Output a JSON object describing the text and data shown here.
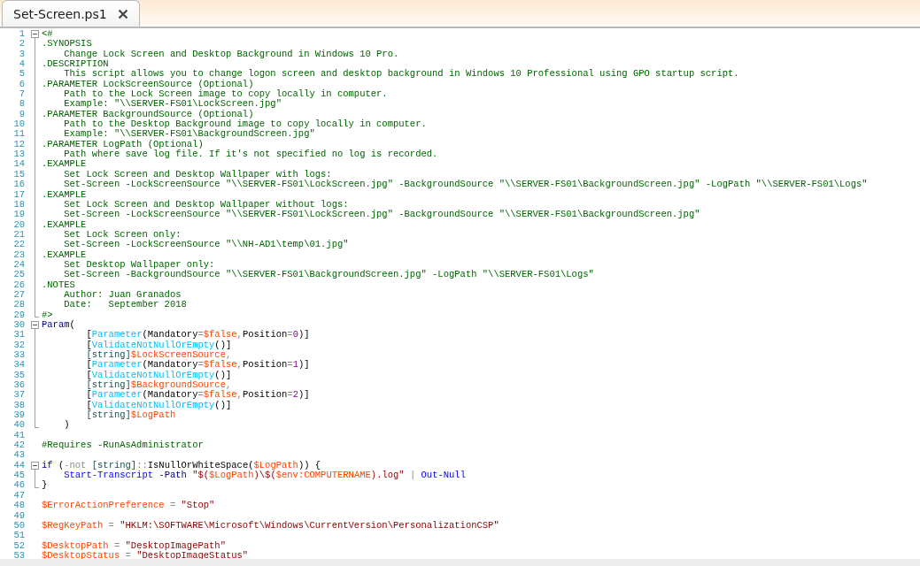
{
  "tab": {
    "title": "Set-Screen.ps1",
    "selected": true
  },
  "lines": [
    {
      "number": "1",
      "expanded": true,
      "tokens": [
        {
          "kind": "comment",
          "text": "<#"
        }
      ],
      "children": [
        {
          "number": "2",
          "tokens": [
            {
              "kind": "comment",
              "text": ".SYNOPSIS"
            }
          ]
        },
        {
          "number": "3",
          "tokens": [
            {
              "kind": "comment",
              "text": "    Change Lock Screen and Desktop Background in Windows 10 Pro."
            }
          ]
        },
        {
          "number": "4",
          "tokens": [
            {
              "kind": "comment",
              "text": ".DESCRIPTION"
            }
          ]
        },
        {
          "number": "5",
          "tokens": [
            {
              "kind": "comment",
              "text": "    This script allows you to change logon screen and desktop background in Windows 10 Professional using GPO startup script."
            }
          ]
        },
        {
          "number": "6",
          "tokens": [
            {
              "kind": "comment",
              "text": ".PARAMETER LockScreenSource (Optional)"
            }
          ]
        },
        {
          "number": "7",
          "tokens": [
            {
              "kind": "comment",
              "text": "    Path to the Lock Screen image to copy locally in computer."
            }
          ]
        },
        {
          "number": "8",
          "tokens": [
            {
              "kind": "comment",
              "text": "    Example: \"\\\\SERVER-FS01\\LockScreen.jpg\""
            }
          ]
        },
        {
          "number": "9",
          "tokens": [
            {
              "kind": "comment",
              "text": ".PARAMETER BackgroundSource (Optional)"
            }
          ]
        },
        {
          "number": "10",
          "tokens": [
            {
              "kind": "comment",
              "text": "    Path to the Desktop Background image to copy locally in computer."
            }
          ]
        },
        {
          "number": "11",
          "tokens": [
            {
              "kind": "comment",
              "text": "    Example: \"\\\\SERVER-FS01\\BackgroundScreen.jpg\""
            }
          ]
        },
        {
          "number": "12",
          "tokens": [
            {
              "kind": "comment",
              "text": ".PARAMETER LogPath (Optional)"
            }
          ]
        },
        {
          "number": "13",
          "tokens": [
            {
              "kind": "comment",
              "text": "    Path where save log file. If it's not specified no log is recorded."
            }
          ]
        },
        {
          "number": "14",
          "tokens": [
            {
              "kind": "comment",
              "text": ".EXAMPLE"
            }
          ]
        },
        {
          "number": "15",
          "tokens": [
            {
              "kind": "comment",
              "text": "    Set Lock Screen and Desktop Wallpaper with logs:"
            }
          ]
        },
        {
          "number": "16",
          "tokens": [
            {
              "kind": "comment",
              "text": "    Set-Screen -LockScreenSource \"\\\\SERVER-FS01\\LockScreen.jpg\" -BackgroundSource \"\\\\SERVER-FS01\\BackgroundScreen.jpg\" -LogPath \"\\\\SERVER-FS01\\Logs\""
            }
          ]
        },
        {
          "number": "17",
          "tokens": [
            {
              "kind": "comment",
              "text": ".EXAMPLE"
            }
          ]
        },
        {
          "number": "18",
          "tokens": [
            {
              "kind": "comment",
              "text": "    Set Lock Screen and Desktop Wallpaper without logs:"
            }
          ]
        },
        {
          "number": "19",
          "tokens": [
            {
              "kind": "comment",
              "text": "    Set-Screen -LockScreenSource \"\\\\SERVER-FS01\\LockScreen.jpg\" -BackgroundSource \"\\\\SERVER-FS01\\BackgroundScreen.jpg\""
            }
          ]
        },
        {
          "number": "20",
          "tokens": [
            {
              "kind": "comment",
              "text": ".EXAMPLE"
            }
          ]
        },
        {
          "number": "21",
          "tokens": [
            {
              "kind": "comment",
              "text": "    Set Lock Screen only:"
            }
          ]
        },
        {
          "number": "22",
          "tokens": [
            {
              "kind": "comment",
              "text": "    Set-Screen -LockScreenSource \"\\\\NH-AD1\\temp\\01.jpg\""
            }
          ]
        },
        {
          "number": "23",
          "tokens": [
            {
              "kind": "comment",
              "text": ".EXAMPLE"
            }
          ]
        },
        {
          "number": "24",
          "tokens": [
            {
              "kind": "comment",
              "text": "    Set Desktop Wallpaper only:"
            }
          ]
        },
        {
          "number": "25",
          "tokens": [
            {
              "kind": "comment",
              "text": "    Set-Screen -BackgroundSource \"\\\\SERVER-FS01\\BackgroundScreen.jpg\" -LogPath \"\\\\SERVER-FS01\\Logs\""
            }
          ]
        },
        {
          "number": "26",
          "tokens": [
            {
              "kind": "comment",
              "text": ".NOTES"
            }
          ]
        },
        {
          "number": "27",
          "tokens": [
            {
              "kind": "comment",
              "text": "    Author: Juan Granados"
            }
          ]
        },
        {
          "number": "28",
          "tokens": [
            {
              "kind": "comment",
              "text": "    Date:   September 2018"
            }
          ]
        },
        {
          "number": "29",
          "tokens": [
            {
              "kind": "comment",
              "text": "#>"
            }
          ]
        }
      ]
    },
    {
      "number": "30",
      "expanded": true,
      "tokens": [
        {
          "kind": "keyword",
          "text": "Param"
        },
        {
          "kind": "plain",
          "text": "("
        }
      ],
      "children": [
        {
          "number": "31",
          "tokens": [
            {
              "kind": "plain",
              "text": "        ["
            },
            {
              "kind": "attribute",
              "text": "Parameter"
            },
            {
              "kind": "plain",
              "text": "(Mandatory"
            },
            {
              "kind": "operator",
              "text": "="
            },
            {
              "kind": "variable",
              "text": "$false"
            },
            {
              "kind": "operator",
              "text": ","
            },
            {
              "kind": "plain",
              "text": "Position"
            },
            {
              "kind": "operator",
              "text": "="
            },
            {
              "kind": "number",
              "text": "0"
            },
            {
              "kind": "plain",
              "text": ")]"
            }
          ]
        },
        {
          "number": "32",
          "tokens": [
            {
              "kind": "plain",
              "text": "        ["
            },
            {
              "kind": "attribute",
              "text": "ValidateNotNullOrEmpty"
            },
            {
              "kind": "plain",
              "text": "()]"
            }
          ]
        },
        {
          "number": "33",
          "tokens": [
            {
              "kind": "type",
              "text": "        [string]"
            },
            {
              "kind": "variable",
              "text": "$LockScreenSource"
            },
            {
              "kind": "operator",
              "text": ","
            }
          ]
        },
        {
          "number": "34",
          "tokens": [
            {
              "kind": "plain",
              "text": "        ["
            },
            {
              "kind": "attribute",
              "text": "Parameter"
            },
            {
              "kind": "plain",
              "text": "(Mandatory"
            },
            {
              "kind": "operator",
              "text": "="
            },
            {
              "kind": "variable",
              "text": "$false"
            },
            {
              "kind": "operator",
              "text": ","
            },
            {
              "kind": "plain",
              "text": "Position"
            },
            {
              "kind": "operator",
              "text": "="
            },
            {
              "kind": "number",
              "text": "1"
            },
            {
              "kind": "plain",
              "text": ")]"
            }
          ]
        },
        {
          "number": "35",
          "tokens": [
            {
              "kind": "plain",
              "text": "        ["
            },
            {
              "kind": "attribute",
              "text": "ValidateNotNullOrEmpty"
            },
            {
              "kind": "plain",
              "text": "()]"
            }
          ]
        },
        {
          "number": "36",
          "tokens": [
            {
              "kind": "type",
              "text": "        [string]"
            },
            {
              "kind": "variable",
              "text": "$BackgroundSource"
            },
            {
              "kind": "operator",
              "text": ","
            }
          ]
        },
        {
          "number": "37",
          "tokens": [
            {
              "kind": "plain",
              "text": "        ["
            },
            {
              "kind": "attribute",
              "text": "Parameter"
            },
            {
              "kind": "plain",
              "text": "(Mandatory"
            },
            {
              "kind": "operator",
              "text": "="
            },
            {
              "kind": "variable",
              "text": "$false"
            },
            {
              "kind": "operator",
              "text": ","
            },
            {
              "kind": "plain",
              "text": "Position"
            },
            {
              "kind": "operator",
              "text": "="
            },
            {
              "kind": "number",
              "text": "2"
            },
            {
              "kind": "plain",
              "text": ")]"
            }
          ]
        },
        {
          "number": "38",
          "tokens": [
            {
              "kind": "plain",
              "text": "        ["
            },
            {
              "kind": "attribute",
              "text": "ValidateNotNullOrEmpty"
            },
            {
              "kind": "plain",
              "text": "()]"
            }
          ]
        },
        {
          "number": "39",
          "tokens": [
            {
              "kind": "type",
              "text": "        [string]"
            },
            {
              "kind": "variable",
              "text": "$LogPath"
            }
          ]
        },
        {
          "number": "40",
          "tokens": [
            {
              "kind": "plain",
              "text": "    )"
            }
          ]
        }
      ]
    },
    {
      "number": "41"
    },
    {
      "number": "42",
      "tokens": [
        {
          "kind": "comment",
          "text": "#Requires -RunAsAdministrator"
        }
      ]
    },
    {
      "number": "43"
    },
    {
      "number": "44",
      "expanded": true,
      "tokens": [
        {
          "kind": "keyword",
          "text": "if"
        },
        {
          "kind": "plain",
          "text": " ("
        },
        {
          "kind": "operator",
          "text": "-not"
        },
        {
          "kind": "type",
          "text": " [string]"
        },
        {
          "kind": "operator",
          "text": "::"
        },
        {
          "kind": "plain",
          "text": "IsNullOrWhiteSpace("
        },
        {
          "kind": "variable",
          "text": "$LogPath"
        },
        {
          "kind": "plain",
          "text": ")) {"
        }
      ],
      "children": [
        {
          "number": "45",
          "tokens": [
            {
              "kind": "command",
              "text": "    Start-Transcript"
            },
            {
              "kind": "parameter",
              "text": " -Path"
            },
            {
              "kind": "string",
              "text": " \"$("
            },
            {
              "kind": "variable",
              "text": "$LogPath"
            },
            {
              "kind": "string",
              "text": ")\\$("
            },
            {
              "kind": "variable",
              "text": "$env:COMPUTERNAME"
            },
            {
              "kind": "string",
              "text": ").log\""
            },
            {
              "kind": "operator",
              "text": " |"
            },
            {
              "kind": "command",
              "text": " Out-Null"
            }
          ]
        },
        {
          "number": "46",
          "tokens": [
            {
              "kind": "plain",
              "text": "}"
            }
          ]
        }
      ]
    },
    {
      "number": "47"
    },
    {
      "number": "48",
      "tokens": [
        {
          "kind": "variable",
          "text": "$ErrorActionPreference"
        },
        {
          "kind": "operator",
          "text": " ="
        },
        {
          "kind": "string",
          "text": " \"Stop\""
        }
      ]
    },
    {
      "number": "49"
    },
    {
      "number": "50",
      "tokens": [
        {
          "kind": "variable",
          "text": "$RegKeyPath"
        },
        {
          "kind": "operator",
          "text": " ="
        },
        {
          "kind": "string",
          "text": " \"HKLM:\\SOFTWARE\\Microsoft\\Windows\\CurrentVersion\\PersonalizationCSP\""
        }
      ]
    },
    {
      "number": "51"
    },
    {
      "number": "52",
      "tokens": [
        {
          "kind": "variable",
          "text": "$DesktopPath"
        },
        {
          "kind": "operator",
          "text": " ="
        },
        {
          "kind": "string",
          "text": " \"DesktopImagePath\""
        }
      ]
    },
    {
      "number": "53",
      "tokens": [
        {
          "kind": "variable",
          "text": "$DesktopStatus"
        },
        {
          "kind": "operator",
          "text": " ="
        },
        {
          "kind": "string",
          "text": " \"DesktopImageStatus\""
        }
      ]
    }
  ]
}
